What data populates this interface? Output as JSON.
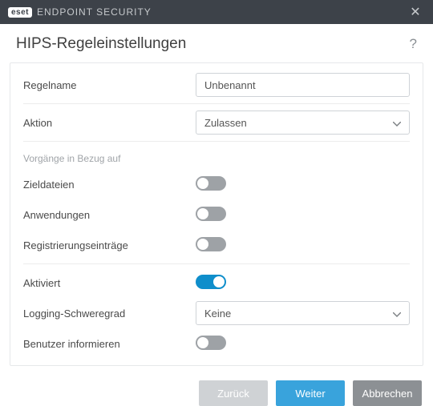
{
  "titlebar": {
    "brand_mark": "eset",
    "brand_text": "ENDPOINT SECURITY"
  },
  "header": {
    "title": "HIPS-Regeleinstellungen"
  },
  "fields": {
    "rule_name_label": "Regelname",
    "rule_name_value": "Unbenannt",
    "action_label": "Aktion",
    "action_value": "Zulassen",
    "operations_section": "Vorgänge in Bezug auf",
    "target_files_label": "Zieldateien",
    "applications_label": "Anwendungen",
    "registry_label": "Registrierungseinträge",
    "enabled_label": "Aktiviert",
    "log_severity_label": "Logging-Schweregrad",
    "log_severity_value": "Keine",
    "notify_label": "Benutzer informieren"
  },
  "toggles": {
    "target_files": false,
    "applications": false,
    "registry": false,
    "enabled": true,
    "notify": false
  },
  "footer": {
    "back": "Zurück",
    "next": "Weiter",
    "cancel": "Abbrechen"
  }
}
